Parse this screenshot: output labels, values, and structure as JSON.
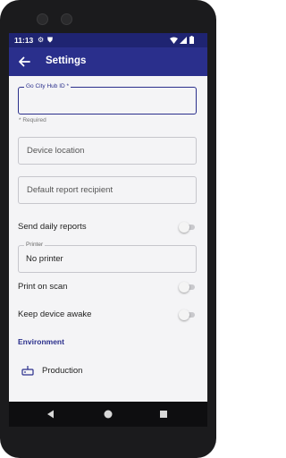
{
  "status_bar": {
    "time": "11:13",
    "left_icons": [
      "gear-icon",
      "shield-icon"
    ],
    "right_icons": [
      "wifi-icon",
      "signal-icon",
      "battery-icon"
    ]
  },
  "app_bar": {
    "title": "Settings",
    "back_icon": "arrow-left-icon",
    "color": "#2a2f8c"
  },
  "fields": {
    "hub_id": {
      "label": "Go City Hub ID *",
      "value": "",
      "helper": "* Required"
    },
    "device_location": {
      "placeholder": "Device location"
    },
    "report_recipient": {
      "placeholder": "Default report recipient"
    },
    "printer": {
      "label": "Printer",
      "value": "No printer"
    }
  },
  "toggles": {
    "send_daily_reports": {
      "label": "Send daily reports",
      "on": false
    },
    "print_on_scan": {
      "label": "Print on scan",
      "on": false
    },
    "keep_awake": {
      "label": "Keep device awake",
      "on": false
    }
  },
  "environment": {
    "section_title": "Environment",
    "selected": "Production",
    "icon": "server-icon"
  },
  "nav_bar": {
    "icons": [
      "back-triangle-icon",
      "home-circle-icon",
      "recents-square-icon"
    ]
  }
}
